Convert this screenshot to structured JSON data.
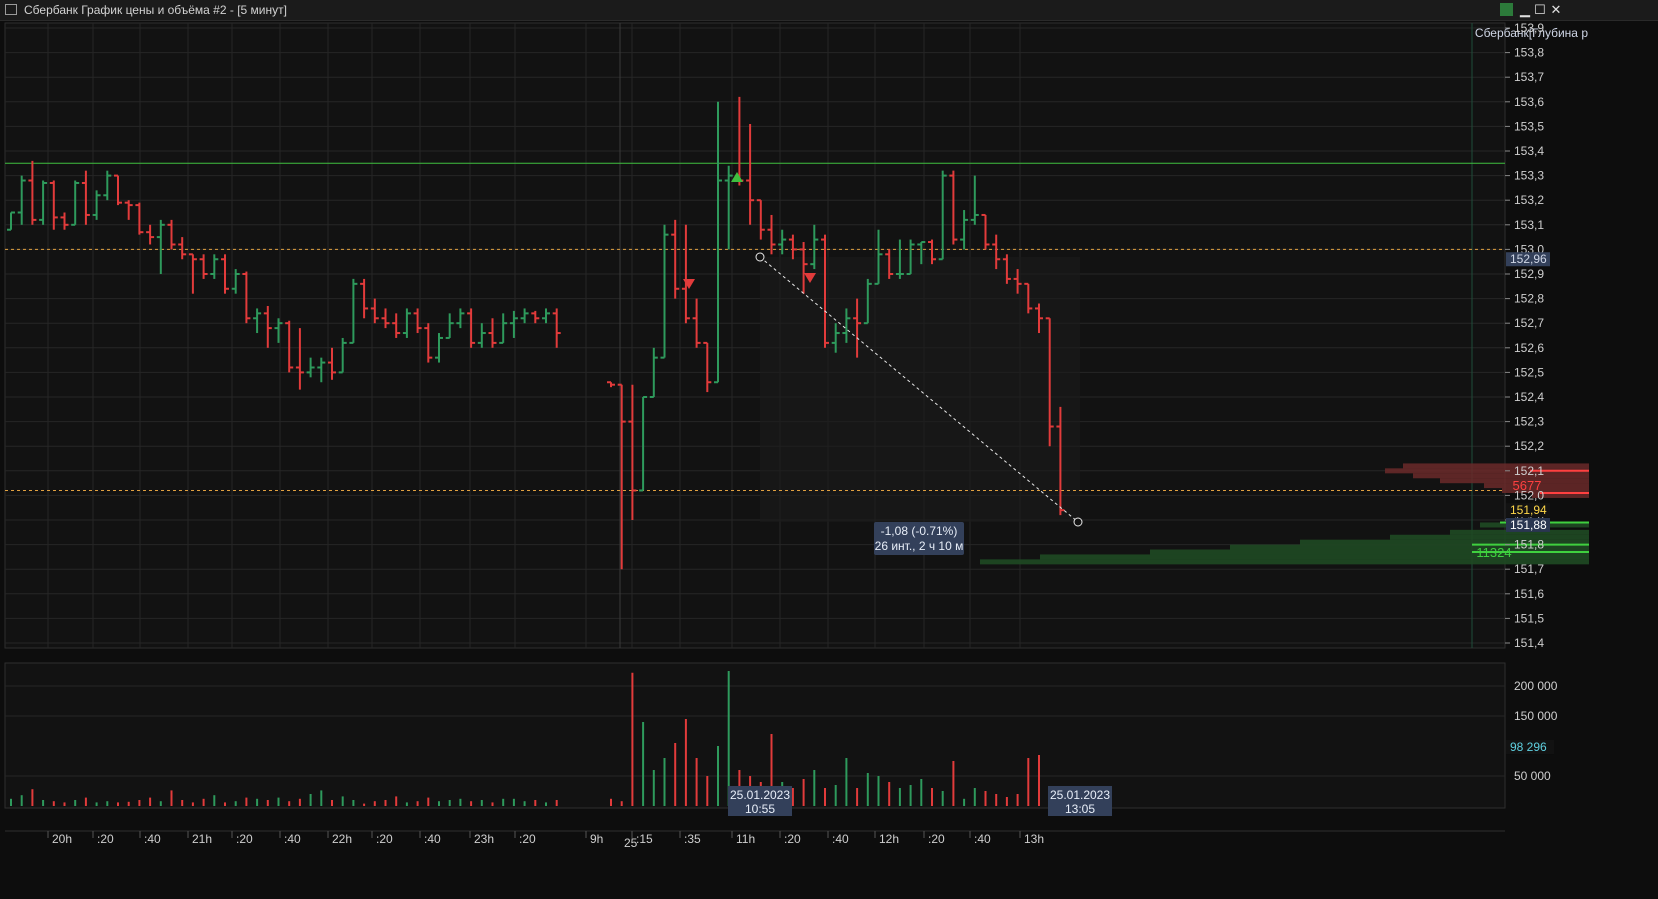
{
  "window": {
    "title": "Сбербанк График цены и объёма #2 - [5 минут]",
    "edit_icon": "chart-edit-icon",
    "minimize_label": "▁",
    "maximize_label": "☐",
    "close_label": "✕"
  },
  "depth_panel_label": "Сбербанк[Глубина р",
  "price_axis_labels": [
    "153,9",
    "153,8",
    "153,7",
    "153,6",
    "153,5",
    "153,4",
    "153,3",
    "153,2",
    "153,1",
    "153,0",
    "152,9",
    "152,8",
    "152,7",
    "152,6",
    "152,5",
    "152,4",
    "152,3",
    "152,2",
    "152,1",
    "152,0",
    "151,9",
    "151,8",
    "151,7",
    "151,6",
    "151,5",
    "151,4"
  ],
  "price_tags": [
    {
      "value": "152,96",
      "color": "#cfd6e6"
    },
    {
      "value": "151,94",
      "color": "#ffd84a"
    },
    {
      "value": "151,88",
      "color": "#ffffff"
    }
  ],
  "volume_axis_labels": [
    "200 000",
    "150 000",
    "50 000"
  ],
  "volume_tag": "98 296",
  "time_axis_labels": [
    "20h",
    ":20",
    ":40",
    "21h",
    ":20",
    ":40",
    "22h",
    ":20",
    ":40",
    "23h",
    ":20",
    "9h",
    ":15",
    ":35",
    "11h",
    ":20",
    ":40",
    "12h",
    ":20",
    ":40",
    "13h"
  ],
  "date_label": "25",
  "measure": {
    "line1": "-1,08 (-0.71%)",
    "line2": "26 инт., 2 ч 10 м"
  },
  "cursor_labels": [
    {
      "date": "25.01.2023",
      "time": "10:55"
    },
    {
      "date": "25.01.2023",
      "time": "13:05"
    }
  ],
  "order_book": {
    "ask_volume": "5677",
    "bid_volume": "11324"
  },
  "colors": {
    "up": "#2e9a5c",
    "down": "#e23b3b",
    "level_green": "#3fbf3f",
    "level_orange": "#e0a040",
    "panel_bg": "#121212"
  },
  "chart_data": {
    "type": "ohlc",
    "interval": "5 минут",
    "ylim": [
      151.4,
      153.9
    ],
    "horizontal_levels": [
      153.35,
      153.0,
      152.02
    ],
    "series": [
      {
        "ohlc": [
          [
            153.08,
            153.15,
            153.08,
            153.15
          ],
          [
            153.15,
            153.3,
            153.1,
            153.28
          ],
          [
            153.28,
            153.36,
            153.1,
            153.12
          ],
          [
            153.12,
            153.28,
            153.1,
            153.27
          ],
          [
            153.27,
            153.28,
            153.08,
            153.13
          ],
          [
            153.13,
            153.15,
            153.08,
            153.1
          ],
          [
            153.1,
            153.28,
            153.1,
            153.27
          ],
          [
            153.27,
            153.32,
            153.1,
            153.14
          ],
          [
            153.14,
            153.24,
            153.12,
            153.22
          ],
          [
            153.22,
            153.32,
            153.2,
            153.3
          ],
          [
            153.3,
            153.3,
            153.18,
            153.19
          ],
          [
            153.19,
            153.2,
            153.12,
            153.18
          ],
          [
            153.18,
            153.19,
            153.06,
            153.07
          ],
          [
            153.07,
            153.1,
            153.02,
            153.05
          ],
          [
            153.05,
            153.12,
            152.9,
            153.1
          ],
          [
            153.1,
            153.12,
            153.0,
            153.02
          ],
          [
            153.02,
            153.05,
            152.96,
            152.98
          ],
          [
            152.98,
            152.98,
            152.82,
            152.96
          ],
          [
            152.96,
            152.98,
            152.88,
            152.9
          ],
          [
            152.9,
            152.98,
            152.88,
            152.96
          ],
          [
            152.96,
            152.98,
            152.82,
            152.84
          ],
          [
            152.84,
            152.92,
            152.82,
            152.9
          ],
          [
            152.9,
            152.91,
            152.7,
            152.72
          ],
          [
            152.72,
            152.76,
            152.66,
            152.74
          ],
          [
            152.74,
            152.77,
            152.6,
            152.68
          ],
          [
            152.68,
            152.72,
            152.62,
            152.7
          ],
          [
            152.7,
            152.71,
            152.5,
            152.52
          ],
          [
            152.52,
            152.68,
            152.43,
            152.5
          ],
          [
            152.5,
            152.56,
            152.48,
            152.52
          ],
          [
            152.52,
            152.56,
            152.46,
            152.54
          ],
          [
            152.54,
            152.6,
            152.47,
            152.5
          ],
          [
            152.5,
            152.64,
            152.5,
            152.62
          ],
          [
            152.62,
            152.88,
            152.62,
            152.86
          ],
          [
            152.86,
            152.88,
            152.72,
            152.76
          ],
          [
            152.76,
            152.8,
            152.7,
            152.72
          ],
          [
            152.72,
            152.76,
            152.68,
            152.7
          ],
          [
            152.7,
            152.74,
            152.64,
            152.66
          ],
          [
            152.66,
            152.76,
            152.64,
            152.74
          ],
          [
            152.74,
            152.76,
            152.66,
            152.68
          ],
          [
            152.68,
            152.7,
            152.54,
            152.56
          ],
          [
            152.56,
            152.66,
            152.54,
            152.64
          ],
          [
            152.64,
            152.74,
            152.64,
            152.7
          ],
          [
            152.7,
            152.76,
            152.68,
            152.74
          ],
          [
            152.74,
            152.76,
            152.6,
            152.62
          ],
          [
            152.62,
            152.7,
            152.6,
            152.66
          ],
          [
            152.66,
            152.72,
            152.6,
            152.62
          ],
          [
            152.62,
            152.74,
            152.62,
            152.7
          ],
          [
            152.7,
            152.75,
            152.64,
            152.72
          ],
          [
            152.72,
            152.76,
            152.7,
            152.74
          ],
          [
            152.74,
            152.75,
            152.7,
            152.72
          ],
          [
            152.72,
            152.76,
            152.7,
            152.74
          ],
          [
            152.74,
            152.76,
            152.6,
            152.66
          ],
          [
            152.46,
            152.46,
            152.44,
            152.45
          ],
          [
            152.45,
            152.45,
            151.7,
            152.3
          ],
          [
            152.3,
            152.45,
            151.9,
            152.02
          ],
          [
            152.02,
            152.4,
            152.02,
            152.4
          ],
          [
            152.4,
            152.6,
            152.4,
            152.56
          ],
          [
            152.56,
            153.1,
            152.56,
            153.06
          ],
          [
            153.06,
            153.12,
            152.8,
            152.84
          ],
          [
            152.84,
            153.1,
            152.7,
            152.72
          ],
          [
            152.72,
            152.8,
            152.6,
            152.62
          ],
          [
            152.62,
            152.62,
            152.42,
            152.46
          ],
          [
            152.46,
            153.6,
            152.46,
            153.28
          ],
          [
            153.28,
            153.34,
            153.0,
            153.3
          ],
          [
            153.3,
            153.62,
            153.26,
            153.28
          ],
          [
            153.28,
            153.51,
            153.1,
            153.2
          ],
          [
            153.2,
            153.2,
            153.04,
            153.08
          ],
          [
            153.08,
            153.14,
            152.98,
            153.02
          ],
          [
            153.02,
            153.08,
            152.98,
            153.04
          ],
          [
            153.04,
            153.06,
            152.96,
            153.0
          ],
          [
            153.0,
            153.03,
            152.82,
            152.94
          ],
          [
            152.94,
            153.1,
            152.92,
            153.04
          ],
          [
            153.04,
            153.06,
            152.6,
            152.62
          ],
          [
            152.62,
            152.7,
            152.58,
            152.66
          ],
          [
            152.66,
            152.76,
            152.62,
            152.72
          ],
          [
            152.72,
            152.8,
            152.56,
            152.7
          ],
          [
            152.7,
            152.88,
            152.7,
            152.86
          ],
          [
            152.86,
            153.08,
            152.86,
            152.98
          ],
          [
            152.98,
            153.0,
            152.88,
            152.9
          ],
          [
            152.9,
            153.04,
            152.88,
            152.9
          ],
          [
            152.9,
            153.04,
            152.9,
            153.02
          ],
          [
            153.02,
            153.03,
            152.94,
            153.03
          ],
          [
            153.03,
            153.04,
            152.94,
            152.96
          ],
          [
            152.96,
            153.32,
            152.96,
            153.3
          ],
          [
            153.3,
            153.32,
            153.02,
            153.04
          ],
          [
            153.04,
            153.16,
            153.0,
            153.12
          ],
          [
            153.12,
            153.3,
            153.1,
            153.14
          ],
          [
            153.14,
            153.14,
            153.0,
            153.02
          ],
          [
            153.02,
            153.06,
            152.92,
            152.96
          ],
          [
            152.96,
            152.98,
            152.86,
            152.88
          ],
          [
            152.88,
            152.92,
            152.82,
            152.86
          ],
          [
            152.86,
            152.86,
            152.74,
            152.76
          ],
          [
            152.76,
            152.78,
            152.66,
            152.72
          ],
          [
            152.72,
            152.72,
            152.2,
            152.28
          ],
          [
            152.28,
            152.36,
            151.92,
            151.94
          ]
        ],
        "volume": [
          12000,
          18000,
          28000,
          10000,
          8000,
          6000,
          10000,
          14000,
          6000,
          8000,
          6000,
          7000,
          10000,
          14000,
          8000,
          26000,
          10000,
          6000,
          12000,
          18000,
          6000,
          8000,
          14000,
          12000,
          10000,
          14000,
          8000,
          12000,
          20000,
          26000,
          10000,
          16000,
          10000,
          4000,
          8000,
          10000,
          16000,
          6000,
          8000,
          14000,
          8000,
          10000,
          12000,
          8000,
          10000,
          6000,
          12000,
          12000,
          8000,
          10000,
          6000,
          10000,
          12000,
          8000,
          222000,
          140000,
          60000,
          80000,
          105000,
          145000,
          80000,
          50000,
          100000,
          225000,
          60000,
          50000,
          40000,
          120000,
          40000,
          30000,
          45000,
          60000,
          30000,
          35000,
          80000,
          30000,
          55000,
          50000,
          40000,
          30000,
          35000,
          45000,
          30000,
          25000,
          75000,
          12000,
          30000,
          25000,
          20000,
          15000,
          20000,
          80000,
          85000
        ]
      }
    ]
  }
}
